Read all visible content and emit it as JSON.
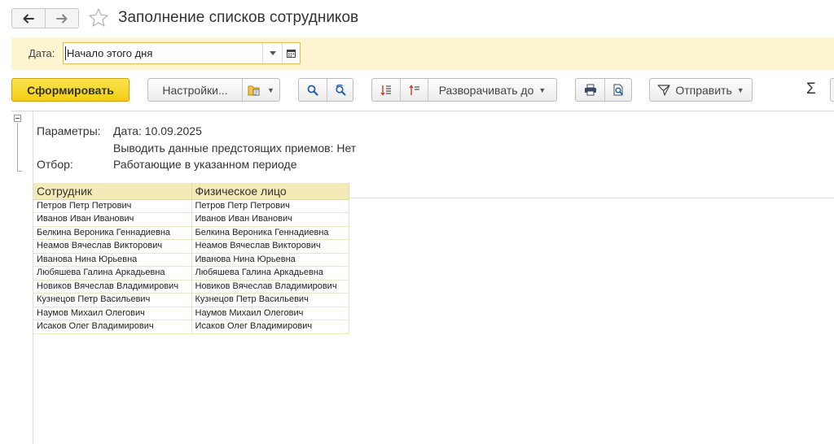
{
  "title": "Заполнение списков сотрудников",
  "nav": {
    "back_icon": "arrow-left-icon",
    "forward_icon": "arrow-right-icon",
    "favorite_icon": "star-icon"
  },
  "period": {
    "label": "Дата:",
    "value": "Начало этого дня"
  },
  "toolbar": {
    "generate_label": "Сформировать",
    "settings_label": "Настройки...",
    "expand_label": "Разворачивать до",
    "send_label": "Отправить",
    "sum_label": "Σ"
  },
  "report": {
    "params_label": "Параметры:",
    "param_date": "Дата: 10.09.2025",
    "param_upcoming": "Выводить данные предстоящих приемов: Нет",
    "filter_label": "Отбор:",
    "filter_value": "Работающие в указанном периоде",
    "columns": [
      "Сотрудник",
      "Физическое лицо"
    ],
    "rows": [
      [
        "Петров Петр Петрович",
        "Петров Петр Петрович"
      ],
      [
        "Иванов Иван Иванович",
        "Иванов Иван Иванович"
      ],
      [
        "Белкина Вероника Геннадиевна",
        "Белкина Вероника Геннадиевна"
      ],
      [
        "Неамов Вячеслав Викторович",
        "Неамов Вячеслав Викторович"
      ],
      [
        "Иванова Нина Юрьевна",
        "Иванова Нина Юрьевна"
      ],
      [
        "Любяшева Галина Аркадьевна",
        "Любяшева Галина Аркадьевна"
      ],
      [
        "Новиков Вячеслав Владимирович",
        "Новиков Вячеслав Владимирович"
      ],
      [
        "Кузнецов Петр Васильевич",
        "Кузнецов Петр Васильевич"
      ],
      [
        "Наумов Михаил Олегович",
        "Наумов Михаил Олегович"
      ],
      [
        "Исаков Олег Владимирович",
        "Исаков Олег Владимирович"
      ]
    ]
  },
  "colors": {
    "accent": "#f2cd14",
    "date_bar": "#fcf5d0",
    "table_header": "#f4eab8"
  }
}
